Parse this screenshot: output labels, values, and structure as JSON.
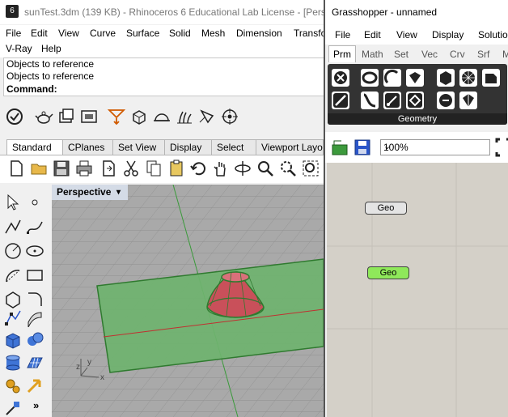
{
  "rhino": {
    "title": "sunTest.3dm (139 KB) - Rhinoceros 6 Educational Lab License - [Perspective]",
    "menu": [
      "File",
      "Edit",
      "View",
      "Curve",
      "Surface",
      "Solid",
      "Mesh",
      "Dimension",
      "Transform"
    ],
    "menu_row2": [
      "V-Ray",
      "Help"
    ],
    "command_history": [
      "Objects to reference",
      "Objects to reference"
    ],
    "command_prompt": "Command:",
    "tabs": [
      "Standard",
      "CPlanes",
      "Set View",
      "Display",
      "Select",
      "Viewport Layout"
    ],
    "active_tab": "Standard",
    "viewport_label": "Perspective",
    "axis_x": "x",
    "axis_y": "y",
    "axis_z": "z"
  },
  "grasshopper": {
    "title": "Grasshopper - unnamed",
    "menu": [
      "File",
      "Edit",
      "View",
      "Display",
      "Solution"
    ],
    "tabs": [
      "Prm",
      "Math",
      "Set",
      "Vec",
      "Crv",
      "Srf",
      "M"
    ],
    "active_tab": "Prm",
    "palette_category": "Geometry",
    "zoom": "100%",
    "nodes": [
      {
        "label": "Geo",
        "state": "default"
      },
      {
        "label": "Geo",
        "state": "selected"
      }
    ]
  },
  "colors": {
    "ground_plane": "#6fb36f",
    "cone": "#c9505a",
    "node_selected": "#8fe85a",
    "gh_canvas": "#d4d0c8",
    "viewport_bg": "#a9a9a9"
  }
}
